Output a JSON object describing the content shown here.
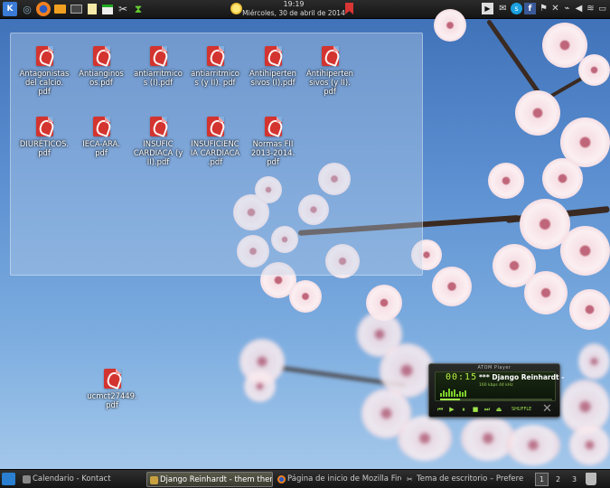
{
  "top_panel": {
    "launchers": [
      "kde-menu-icon",
      "app-switcher-icon",
      "firefox-icon",
      "folder-icon",
      "terminal-icon",
      "notes-icon",
      "mail-icon",
      "tools-icon",
      "update-icon"
    ],
    "clock": {
      "time": "19:19",
      "date": "Miércoles, 30 de abril de 2014"
    },
    "tray": [
      "media-play-icon",
      "mail-icon",
      "skype-icon",
      "facebook-icon",
      "flag-icon",
      "scissors-icon",
      "usb-icon",
      "volume-icon",
      "wifi-icon",
      "battery-icon",
      "expand-icon"
    ]
  },
  "desktop": {
    "files": [
      {
        "name": "Antagonistas\ndel calcio.\npdf"
      },
      {
        "name": "Antianginos\nos.pdf"
      },
      {
        "name": "antiarritmico\ns (I).pdf"
      },
      {
        "name": "antiarritmico\ns (y II). pdf"
      },
      {
        "name": "Antihiperten\nsivos (I).pdf"
      },
      {
        "name": "Antihiperten\nsivos (y II).\npdf"
      },
      {
        "name": "DIURÉTICOS.\npdf"
      },
      {
        "name": "IECA-ARA.\npdf"
      },
      {
        "name": "INSUFIC\nCARDIACA (y\nII).pdf"
      },
      {
        "name": "INSUFICIENC\nIA CARDIACA\n.pdf"
      },
      {
        "name": "Normas FII\n2013-2014.\npdf"
      }
    ],
    "loose_file": {
      "name": "ucmct27449.\npdf"
    }
  },
  "player": {
    "title": "ATOM Player",
    "time": "00:15",
    "track": "*** Django Reinhardt -",
    "info": "160 kbps  44 kHz",
    "shuffle_label": "SHUFFLE",
    "progress": 0.18
  },
  "taskbar": {
    "tasks": [
      {
        "label": "Calendario - Kontact",
        "active": false
      },
      {
        "label": "Django Reinhardt - them there eyes",
        "active": true
      },
      {
        "label": "Página de inicio de Mozilla Firefox",
        "active": false
      },
      {
        "label": "Tema de escritorio – Preferencias",
        "active": false
      }
    ],
    "desktops": [
      "1",
      "2",
      "3"
    ],
    "current_desktop": "1"
  },
  "colors": {
    "panel": "#1e1e1e",
    "sky": "#5a8ed0",
    "blossom": "#f6dfe4",
    "player_accent": "#9ee64a"
  }
}
